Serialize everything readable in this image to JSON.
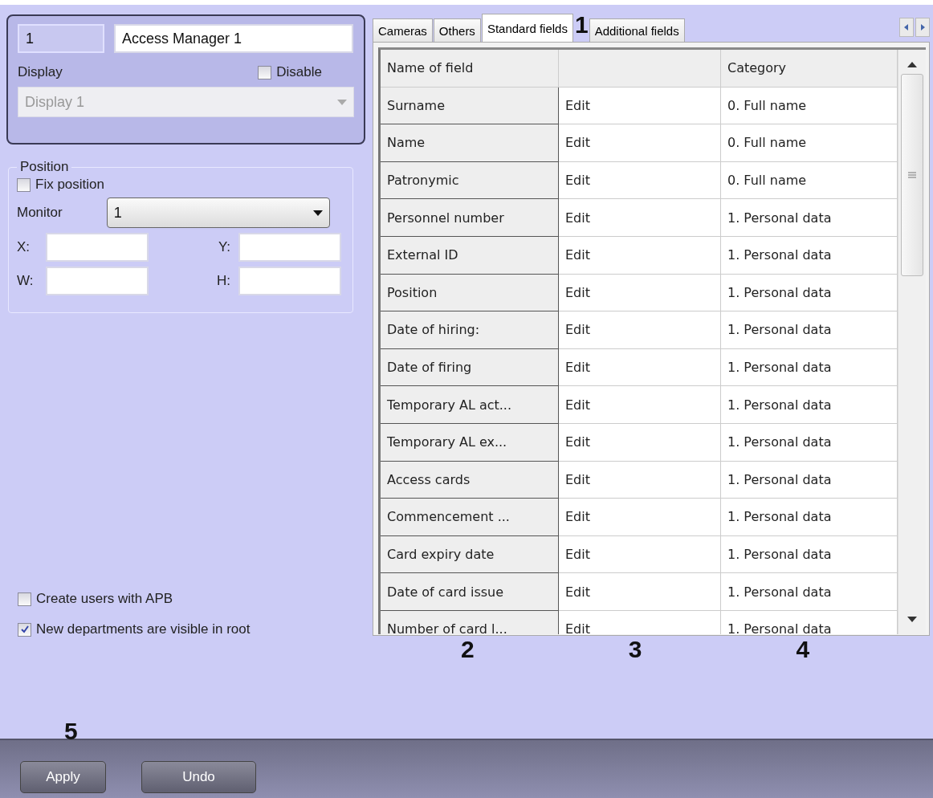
{
  "object": {
    "number": "1",
    "name": "Access Manager 1",
    "display_label": "Display",
    "disable": {
      "label": "Disable",
      "checked": false
    },
    "display_value": "Display 1",
    "display_disabled": true
  },
  "position": {
    "title": "Position",
    "fix": {
      "label": "Fix position",
      "checked": false
    },
    "monitor_label": "Monitor",
    "monitor_value": "1",
    "coords": [
      {
        "label": "X:"
      },
      {
        "label": "Y:"
      },
      {
        "label": "W:"
      },
      {
        "label": "H:"
      }
    ]
  },
  "options": [
    {
      "label": "Create users with APB",
      "checked": false
    },
    {
      "label": "New departments are visible in root",
      "checked": true
    }
  ],
  "tabs": [
    {
      "label": "Cameras",
      "selected": false
    },
    {
      "label": "Others",
      "selected": false
    },
    {
      "label": "Standard fields",
      "selected": true
    },
    {
      "label": "Additional fields",
      "selected": false
    }
  ],
  "table": {
    "columns": {
      "column_1": "Name of field",
      "column_3": "Category"
    },
    "rows": [
      {
        "name": "Surname",
        "editor": "Edit",
        "category": "0. Full name"
      },
      {
        "name": "Name",
        "editor": "Edit",
        "category": "0. Full name"
      },
      {
        "name": "Patronymic",
        "editor": "Edit",
        "category": "0. Full name"
      },
      {
        "name": "Personnel number",
        "editor": "Edit",
        "category": "1. Personal data"
      },
      {
        "name": "External ID",
        "editor": "Edit",
        "category": "1. Personal data"
      },
      {
        "name": "Position",
        "editor": "Edit",
        "category": "1. Personal data"
      },
      {
        "name": "Date of hiring:",
        "editor": "Edit",
        "category": "1. Personal data"
      },
      {
        "name": "Date of firing",
        "editor": "Edit",
        "category": "1. Personal data"
      },
      {
        "name": "Temporary AL act...",
        "editor": "Edit",
        "category": "1. Personal data"
      },
      {
        "name": "Temporary AL ex...",
        "editor": "Edit",
        "category": "1. Personal data"
      },
      {
        "name": "Access cards",
        "editor": "Edit",
        "category": "1. Personal data"
      },
      {
        "name": "Commencement ...",
        "editor": "Edit",
        "category": "1. Personal data"
      },
      {
        "name": "Card expiry date",
        "editor": "Edit",
        "category": "1. Personal data"
      },
      {
        "name": "Date of card issue",
        "editor": "Edit",
        "category": "1. Personal data"
      },
      {
        "name": "Number of card l...",
        "editor": "Edit",
        "category": "1. Personal data"
      }
    ]
  },
  "column_callouts": [
    "2",
    "3",
    "4"
  ],
  "tab_callout": "1",
  "button_callout": "5",
  "buttons": [
    {
      "label": "Apply"
    },
    {
      "label": "Undo"
    }
  ]
}
